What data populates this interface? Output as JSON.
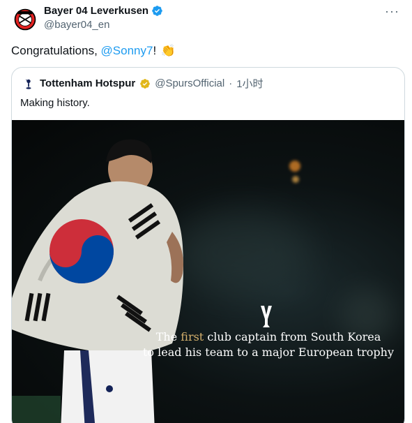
{
  "tweet": {
    "author_name": "Bayer 04 Leverkusen",
    "author_handle": "@bayer04_en",
    "text_before": "Congratulations, ",
    "mention": "@Sonny7",
    "text_after": "! ",
    "emoji": "👏"
  },
  "quote": {
    "author_name": "Tottenham Hotspur",
    "author_handle": "@SpursOfficial",
    "separator": "·",
    "time": "1小时",
    "text": "Making history.",
    "image_caption": {
      "line1_before": "The ",
      "line1_highlight": "first",
      "line1_after": " club captain from South Korea",
      "line2": "to lead his team to a major European trophy"
    }
  },
  "ui": {
    "more_icon": "more-horizontal-icon",
    "verified_color": "#1d9bf0",
    "org_badge_color": "#e2b719",
    "mention_color": "#1d9bf0",
    "highlight_color": "#d5b06c"
  }
}
